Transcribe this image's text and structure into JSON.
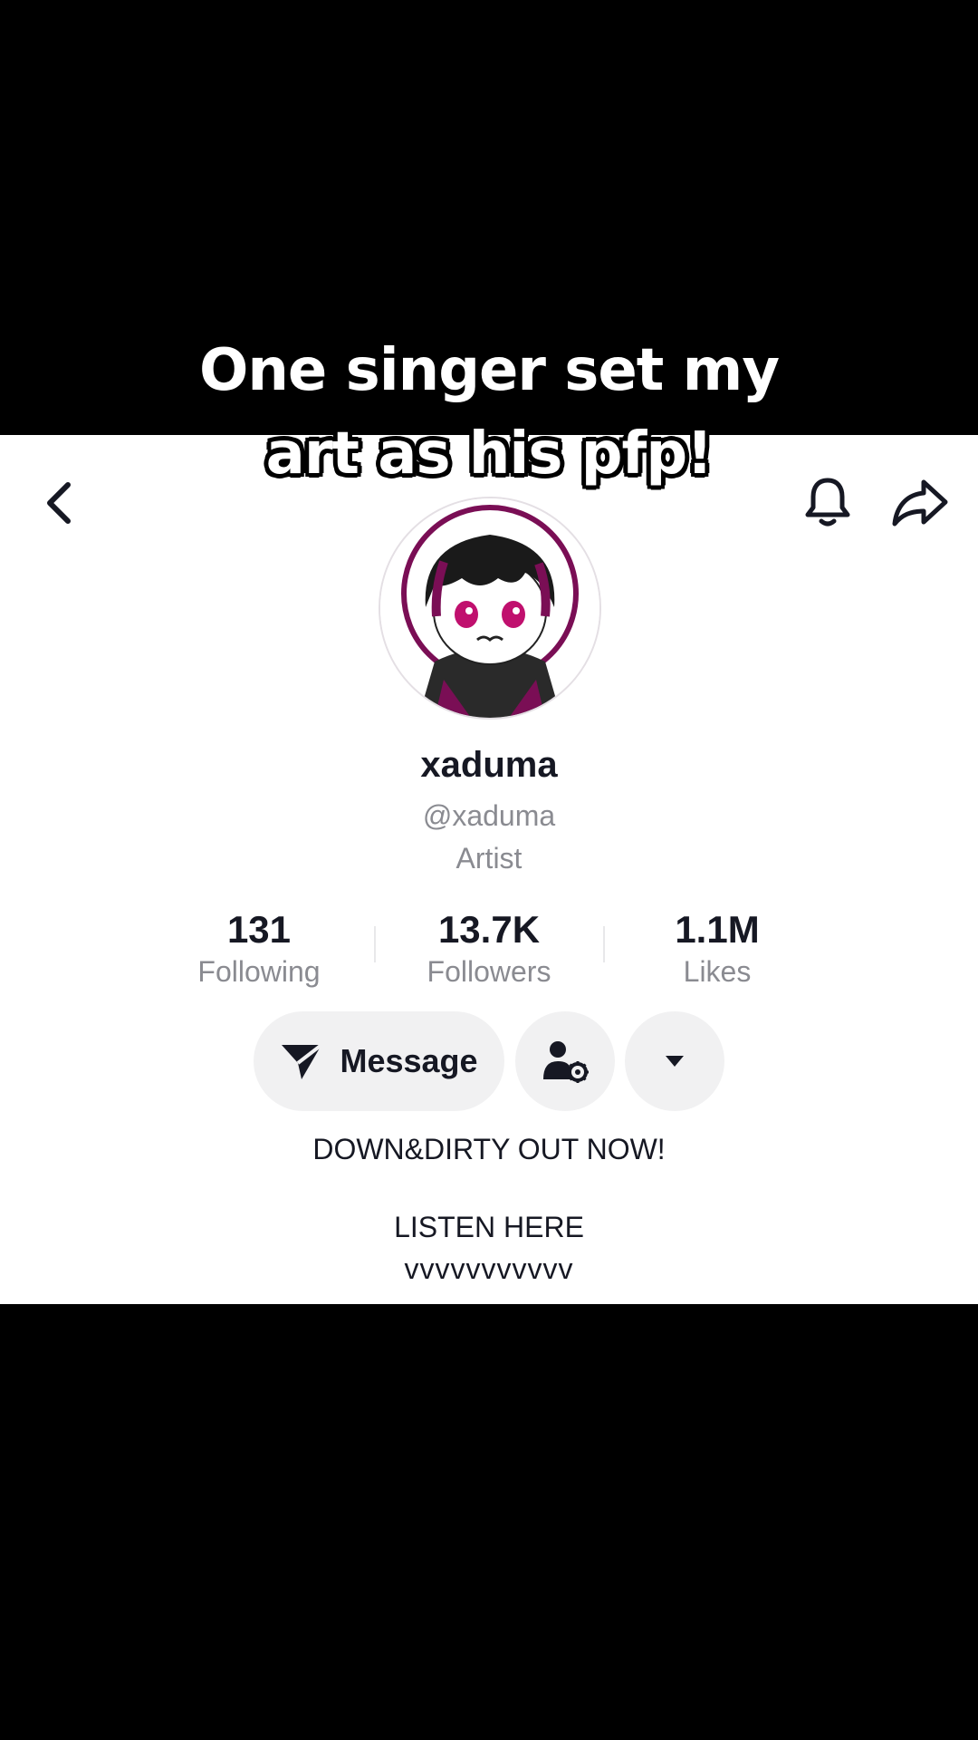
{
  "caption": {
    "line1": "One singer set my",
    "line2": "art as his pfp!"
  },
  "icons": {
    "back": "chevron-left-icon",
    "bell": "bell-icon",
    "share": "share-arrow-icon",
    "message": "send-icon",
    "add_friend": "user-settings-icon",
    "more": "caret-down-icon"
  },
  "profile": {
    "name": "xaduma",
    "handle": "@xaduma",
    "category": "Artist"
  },
  "stats": [
    {
      "value": "131",
      "label": "Following"
    },
    {
      "value": "13.7K",
      "label": "Followers"
    },
    {
      "value": "1.1M",
      "label": "Likes"
    }
  ],
  "actions": {
    "message_label": "Message"
  },
  "bio": {
    "line1": "DOWN&DIRTY OUT NOW!",
    "line2": "LISTEN HERE",
    "line3": "vvvvvvvvvvv"
  },
  "colors": {
    "avatar_accent": "#7a0e55",
    "button_bg": "#f1f1f2",
    "secondary_text": "#8a8b91"
  }
}
